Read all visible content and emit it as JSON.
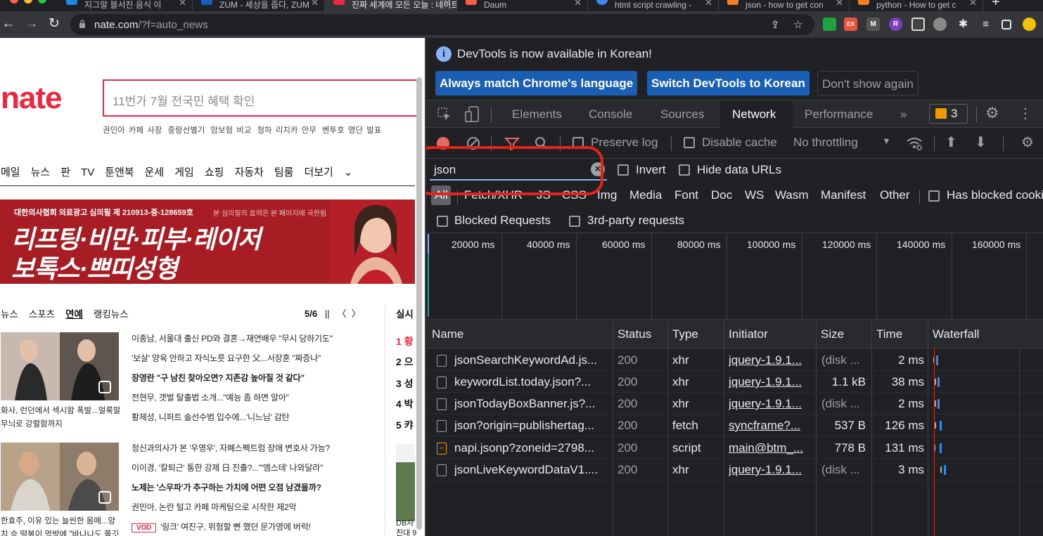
{
  "browser": {
    "tabs": [
      {
        "title": "지그알 블서진 음식 이",
        "favicon": "#1e88e5",
        "active": false
      },
      {
        "title": "ZUM - 세상을 줍다, ZUM",
        "favicon": "#1560bd",
        "active": false
      },
      {
        "title": "진짜 세계에 모든 오늘 : 네이트",
        "favicon": "#f0253e",
        "active": true
      },
      {
        "title": "Daum",
        "favicon": "#ff5a4a",
        "active": false
      },
      {
        "title": "html script crawling -",
        "favicon": "#4285f4",
        "active": false
      },
      {
        "title": "json - how to get con",
        "favicon": "#f48024",
        "active": false
      },
      {
        "title": "python - How to get c",
        "favicon": "#f48024",
        "active": false
      }
    ],
    "url_host": "nate.com",
    "url_path": "/?f=auto_news"
  },
  "page": {
    "logo": "nate",
    "search_placeholder": "11번가 7월 전국민 혜택 확인",
    "keywords": [
      "권민아 카페 사장",
      "중랑선별기",
      "암보험 비교",
      "청하 리치카 안무",
      "벤투호 명단 발표"
    ],
    "menu": [
      "메일",
      "뉴스",
      "판",
      "TV",
      "툰앤북",
      "운세",
      "게임",
      "쇼핑",
      "자동차",
      "팀룸",
      "더보기"
    ],
    "ad": {
      "notice": "대한의사협회 의료광고 심의필 제 210913-중-128659호",
      "notice2": "본 심의필의 효력은 본 페이지에 국한됨",
      "line1": "리프팅·비만·피부·레이저",
      "line2": "보톡스·쁘띠성형"
    },
    "news_tabs": [
      "뉴스",
      "스포츠",
      "연예",
      "랭킹뉴스"
    ],
    "pager": "5/6",
    "side_title": "실시",
    "ranks": [
      "1 황",
      "2 으",
      "3 성",
      "4 박",
      "5 캬"
    ],
    "caption1": "화사, 런던에서 섹시함 폭발...얼룩말 무늬로 강렬함까지",
    "caption2": "한효주, 이유 있는 늘씬한 몸매...양치 승 떡볶이 먹방에 \"바나나도 쫄깃해",
    "headlines": [
      {
        "text": "이종남, 서울대 출신 PD와 결혼→재연배우 \"무시 당하기도\"",
        "bold": false
      },
      {
        "text": "'보살' 양육 안하고 자식노릇 요구한 父...서장훈 \"짜증나\"",
        "bold": false
      },
      {
        "text": "장영란 \"구 남친 찾아오면? 지존감 높아질 것 같다\"",
        "bold": true
      },
      {
        "text": "전현무, 갯벌 탈출법 소개...\"예능 좀 하면 알아\"",
        "bold": false
      },
      {
        "text": "황제성, 니퍼트 솔선수범 입수에...'니느님' 감탄",
        "bold": false
      },
      {
        "text": "정신과의사가 본 '우영우', 자폐스펙트럼 장애 변호사 가능?",
        "bold": false
      },
      {
        "text": "이이경, '칼퇴근' 통한 강제 日 진출?...\"'엠스테' 나와달라\"",
        "bold": false
      },
      {
        "text": "노제는 '스우파'가 추구하는 가치에 어떤 오점 남겼을까?",
        "bold": true
      },
      {
        "text": "권민아, 논란 털고 카페 마케팅으로 시작한 제2막",
        "bold": false
      },
      {
        "text": "'링크' 여진구, 위험할 뻔 했던 문가영에 버럭!",
        "bold": false
      }
    ],
    "vod_badge": "VOD",
    "side_text": "DB자 친대 9"
  },
  "devtools": {
    "info": "DevTools is now available in Korean!",
    "btn_match": "Always match Chrome's language",
    "btn_switch": "Switch DevTools to Korean",
    "btn_dismiss": "Don't show again",
    "tabs": [
      "Elements",
      "Console",
      "Sources",
      "Network",
      "Performance"
    ],
    "more": "»",
    "issues": "3",
    "preserve_log": "Preserve log",
    "disable_cache": "Disable cache",
    "throttling": "No throttling",
    "filter_value": "json",
    "invert": "Invert",
    "hide_data_urls": "Hide data URLs",
    "types": [
      "All",
      "Fetch/XHR",
      "JS",
      "CSS",
      "Img",
      "Media",
      "Font",
      "Doc",
      "WS",
      "Wasm",
      "Manifest",
      "Other"
    ],
    "has_blocked": "Has blocked cookies",
    "blocked_requests": "Blocked Requests",
    "third_party": "3rd-party requests",
    "timeline_ticks": [
      "20000 ms",
      "40000 ms",
      "60000 ms",
      "80000 ms",
      "100000 ms",
      "120000 ms",
      "140000 ms",
      "160000 ms"
    ],
    "columns": [
      "Name",
      "Status",
      "Type",
      "Initiator",
      "Size",
      "Time",
      "Waterfall"
    ],
    "rows": [
      {
        "name": "jsonSearchKeywordAd.js...",
        "status": "200",
        "type": "xhr",
        "initiator": "jquery-1.9.1...",
        "size": "(disk ...",
        "time": "2 ms"
      },
      {
        "name": "keywordList.today.json?...",
        "status": "200",
        "type": "xhr",
        "initiator": "jquery-1.9.1...",
        "size": "1.1 kB",
        "time": "38 ms"
      },
      {
        "name": "jsonTodayBoxBanner.js?...",
        "status": "200",
        "type": "xhr",
        "initiator": "jquery-1.9.1...",
        "size": "(disk ...",
        "time": "2 ms"
      },
      {
        "name": "json?origin=publishertag...",
        "status": "200",
        "type": "fetch",
        "initiator": "syncframe?...",
        "size": "537 B",
        "time": "126 ms"
      },
      {
        "name": "napi.jsonp?zoneid=2798...",
        "status": "200",
        "type": "script",
        "initiator": "main@btm_...",
        "size": "778 B",
        "time": "131 ms"
      },
      {
        "name": "jsonLiveKeywordDataV1....",
        "status": "200",
        "type": "xhr",
        "initiator": "jquery-1.9.1...",
        "size": "(disk ...",
        "time": "3 ms"
      }
    ]
  }
}
